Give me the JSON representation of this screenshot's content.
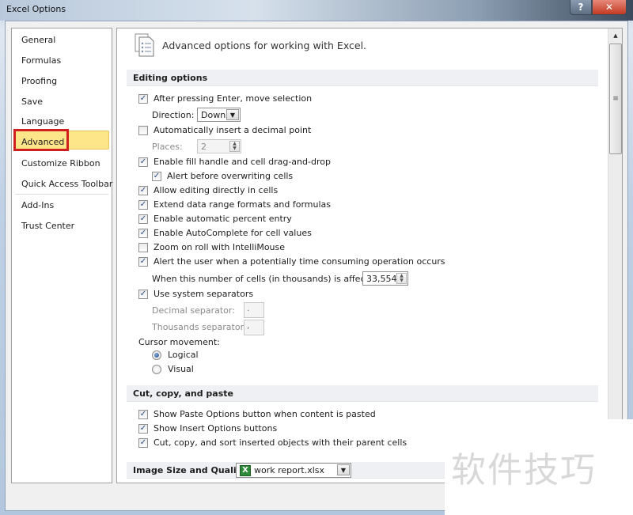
{
  "window": {
    "title": "Excel Options",
    "help_label": "?",
    "close_label": "✕"
  },
  "nav": {
    "items": [
      {
        "label": "General"
      },
      {
        "label": "Formulas"
      },
      {
        "label": "Proofing"
      },
      {
        "label": "Save"
      },
      {
        "label": "Language"
      },
      {
        "label": "Advanced",
        "selected": true
      },
      {
        "label": "Customize Ribbon"
      },
      {
        "label": "Quick Access Toolbar"
      },
      {
        "label": "Add-Ins"
      },
      {
        "label": "Trust Center"
      }
    ]
  },
  "main": {
    "title": "Advanced options for working with Excel.",
    "icon": "document-list-icon",
    "sections": {
      "editing": "Editing options",
      "cut_copy": "Cut, copy, and paste",
      "image": "Image Size and Quality"
    },
    "editing": {
      "after_enter": {
        "label": "After pressing Enter, move selection",
        "checked": true
      },
      "direction_label": "Direction:",
      "direction_value": "Down",
      "decimal_point": {
        "label": "Automatically insert a decimal point",
        "checked": false
      },
      "places_label": "Places:",
      "places_value": "2",
      "fill_handle": {
        "label": "Enable fill handle and cell drag-and-drop",
        "checked": true
      },
      "alert_overwrite": {
        "label": "Alert before overwriting cells",
        "checked": true
      },
      "edit_direct": {
        "label": "Allow editing directly in cells",
        "checked": true
      },
      "extend_range": {
        "label": "Extend data range formats and formulas",
        "checked": true
      },
      "auto_percent": {
        "label": "Enable automatic percent entry",
        "checked": true
      },
      "autocomplete": {
        "label": "Enable AutoComplete for cell values",
        "checked": true
      },
      "zoom_roll": {
        "label": "Zoom on roll with IntelliMouse",
        "checked": false
      },
      "alert_time": {
        "label": "Alert the user when a potentially time consuming operation occurs",
        "checked": true
      },
      "cells_affected_label": "When this number of cells (in thousands) is affected:",
      "cells_affected_value": "33,554",
      "system_separators": {
        "label": "Use system separators",
        "checked": true
      },
      "decimal_sep_label": "Decimal separator:",
      "decimal_sep_value": ".",
      "thousands_sep_label": "Thousands separator:",
      "thousands_sep_value": ",",
      "cursor_movement_label": "Cursor movement:",
      "cursor_logical": {
        "label": "Logical",
        "selected": true
      },
      "cursor_visual": {
        "label": "Visual",
        "selected": false
      }
    },
    "cut_copy": {
      "paste_options": {
        "label": "Show Paste Options button when content is pasted",
        "checked": true
      },
      "insert_options": {
        "label": "Show Insert Options buttons",
        "checked": true
      },
      "cut_sort": {
        "label": "Cut, copy, and sort inserted objects with their parent cells",
        "checked": true
      }
    },
    "image_workbook": "work report.xlsx"
  },
  "watermark": "软件技巧",
  "check_glyph": "✓"
}
